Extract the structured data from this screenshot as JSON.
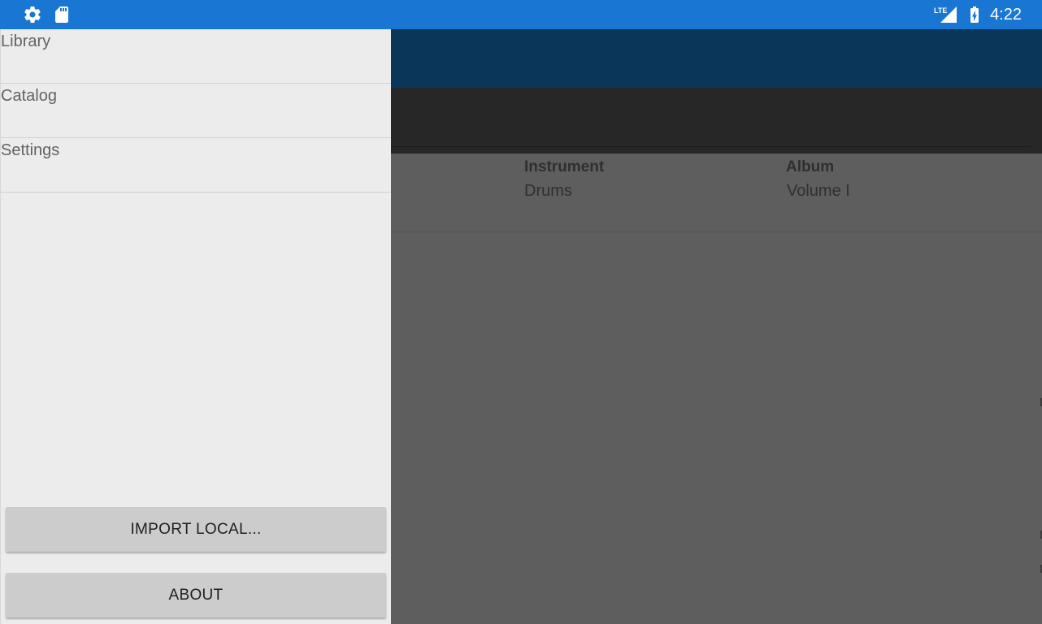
{
  "status_bar": {
    "left_icons": [
      "gear-icon",
      "sd-card-icon"
    ],
    "right_icons": [
      "lte-signal-icon",
      "battery-charging-icon"
    ],
    "network_label": "LTE",
    "time": "4:22",
    "color": "#1976d2"
  },
  "drawer": {
    "items": [
      {
        "label": "Library"
      },
      {
        "label": "Catalog"
      },
      {
        "label": "Settings"
      }
    ],
    "import_button_label": "IMPORT LOCAL...",
    "about_button_label": "ABOUT"
  },
  "list": {
    "columns": [
      {
        "header": "Instrument",
        "value": "Drums"
      },
      {
        "header": "Album",
        "value": "Volume I"
      }
    ]
  },
  "colors": {
    "toolbar": "#0a3659",
    "tabstrip": "#272727",
    "drawer_bg": "#ececec",
    "button_bg": "#cccccc"
  }
}
